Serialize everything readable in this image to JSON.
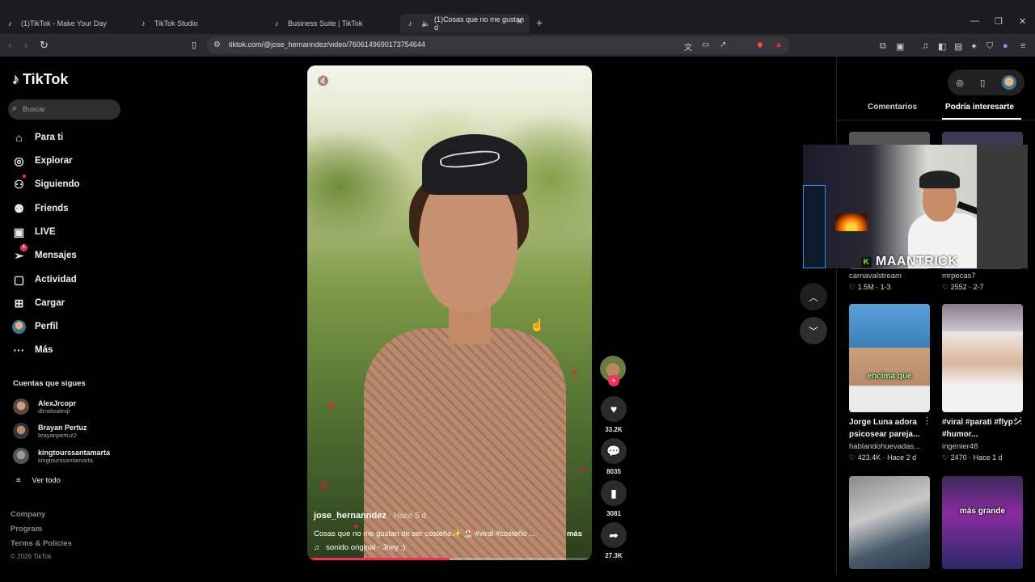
{
  "browser": {
    "tabs": [
      {
        "label": "(1)TikTok - Make Your Day",
        "icon": "tiktok-icon"
      },
      {
        "label": "TikTok Studio",
        "icon": "tiktok-icon"
      },
      {
        "label": "Business Suite | TikTok",
        "icon": "tiktok-icon"
      },
      {
        "label": "(1)Cosas que no me gustan d",
        "icon": "tiktok-icon"
      }
    ],
    "url": "tiktok.com/@jose_hernanndez/video/7606149690173754644"
  },
  "brand": "TikTok",
  "search": {
    "placeholder": "Buscar"
  },
  "nav": [
    {
      "label": "Para ti",
      "icon": "home-icon"
    },
    {
      "label": "Explorar",
      "icon": "compass-icon"
    },
    {
      "label": "Siguiendo",
      "icon": "following-icon"
    },
    {
      "label": "Friends",
      "icon": "friends-icon"
    },
    {
      "label": "LIVE",
      "icon": "live-icon"
    },
    {
      "label": "Mensajes",
      "icon": "messages-icon",
      "badge": "1"
    },
    {
      "label": "Actividad",
      "icon": "activity-icon"
    },
    {
      "label": "Cargar",
      "icon": "upload-icon"
    },
    {
      "label": "Perfil",
      "icon": "avatar"
    },
    {
      "label": "Más",
      "icon": "more-icon"
    }
  ],
  "following": {
    "title": "Cuentas que sigues",
    "accounts": [
      {
        "name": "AlexJrcopr",
        "handle": "dlmeloalexjr"
      },
      {
        "name": "Brayan Pertuz",
        "handle": "brayanpertuz2"
      },
      {
        "name": "kingtourssantamarta",
        "handle": "kingtourssantamarta"
      }
    ],
    "see_all": "Ver todo"
  },
  "footer": {
    "links": [
      "Company",
      "Program",
      "Terms & Policies"
    ],
    "copyright": "© 2026 TikTok"
  },
  "video": {
    "author": "jose_hernanndez",
    "when": "· Hace 5 d",
    "description": "Cosas que no me gustan de ser costeño✨ 🏖️ #viral #costeño ...",
    "more": "más",
    "sound": "sonido original - Jhey :)",
    "progress": 0.5
  },
  "actions": {
    "likes": "33.2K",
    "comments": "8035",
    "saves": "3081",
    "shares": "27.3K"
  },
  "right_panel": {
    "tabs": [
      "Comentarios",
      "Podría interesarte"
    ],
    "row1": [
      {
        "author": "carnavalstream",
        "meta": "♡ 1.5M · 1-3"
      },
      {
        "author": "mrpecas7",
        "meta": "♡ 2552 · 2-7"
      }
    ],
    "row2": [
      {
        "title": "Jorge Luna adora psicosear pareja...",
        "author": "hablandohuevadas...",
        "meta": "♡ 423.4K · Hace 2 d",
        "overlay": "encima que"
      },
      {
        "title": "#viral #parati #flypシ #humor...",
        "author": "ingenier48",
        "meta": "♡ 2470 · Hace 1 d",
        "overlay": ""
      }
    ],
    "row3_overlay": "más grande"
  },
  "webcam": {
    "name": "MAANTRICK"
  }
}
